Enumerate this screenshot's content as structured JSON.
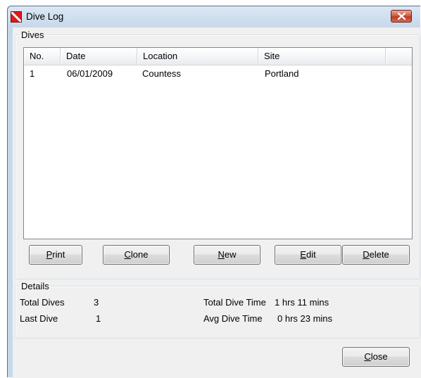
{
  "window": {
    "title": "Dive Log"
  },
  "dives_group": {
    "legend": "Dives",
    "columns": [
      "No.",
      "Date",
      "Location",
      "Site",
      ""
    ],
    "rows": [
      {
        "no": "1",
        "date": "06/01/2009",
        "location": "Countess",
        "site": "Portland"
      }
    ]
  },
  "buttons": {
    "print": {
      "mnemonic": "P",
      "rest": "rint"
    },
    "clone": {
      "mnemonic": "C",
      "rest": "lone"
    },
    "new": {
      "mnemonic": "N",
      "rest": "ew"
    },
    "edit": {
      "mnemonic": "E",
      "rest": "dit"
    },
    "delete": {
      "mnemonic": "D",
      "rest": "elete"
    },
    "close": {
      "mnemonic": "C",
      "rest": "lose"
    }
  },
  "details_group": {
    "legend": "Details",
    "total_dives_label": "Total Dives",
    "total_dives_value": "3",
    "last_dive_label": "Last Dive",
    "last_dive_value": "1",
    "total_dive_time_label": "Total Dive Time",
    "total_dive_time_value": "1 hrs 11 mins",
    "avg_dive_time_label": "Avg Dive Time",
    "avg_dive_time_value": "0 hrs 23 mins"
  },
  "colors": {
    "title_bar": "#c7d8ea",
    "client_bg": "#f0f0f0",
    "close_button": "#c23a24",
    "app_icon": "#e0191d"
  },
  "icons": {
    "app": "dive-flag-icon",
    "close": "close-icon"
  }
}
